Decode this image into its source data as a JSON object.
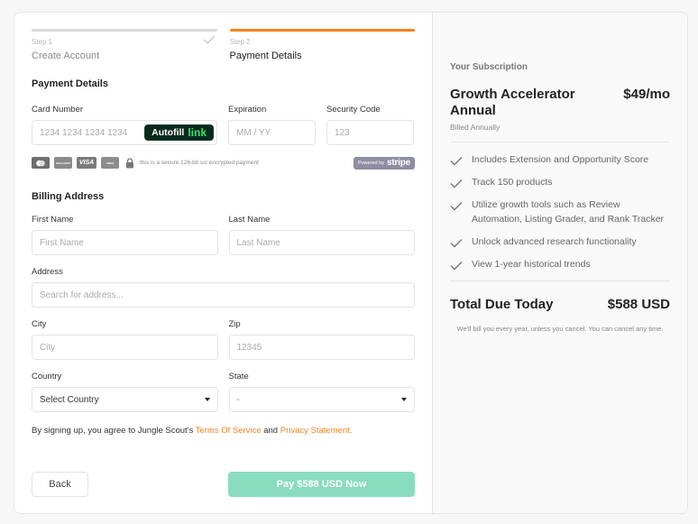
{
  "steps": [
    {
      "num": "Step 1",
      "title": "Create Account",
      "completed": true
    },
    {
      "num": "Step 2",
      "title": "Payment Details",
      "active": true
    }
  ],
  "payment": {
    "section_title": "Payment Details",
    "card_number": {
      "label": "Card Number",
      "placeholder": "1234 1234 1234 1234"
    },
    "autofill": {
      "text": "Autofill",
      "link": "link"
    },
    "expiration": {
      "label": "Expiration",
      "placeholder": "MM / YY"
    },
    "security_code": {
      "label": "Security Code",
      "placeholder": "123"
    },
    "card_brands": [
      "mastercard",
      "discover",
      "visa",
      "amex"
    ],
    "visa_text": "VISA",
    "secure_text": "this is a secure 128-bit ssl encrypted payment",
    "stripe": {
      "powered_by": "Powered by",
      "brand": "stripe"
    }
  },
  "billing": {
    "section_title": "Billing Address",
    "first_name": {
      "label": "First Name",
      "placeholder": "First Name"
    },
    "last_name": {
      "label": "Last Name",
      "placeholder": "Last Name"
    },
    "address": {
      "label": "Address",
      "placeholder": "Search for address..."
    },
    "city": {
      "label": "City",
      "placeholder": "City"
    },
    "zip": {
      "label": "Zip",
      "placeholder": "12345"
    },
    "country": {
      "label": "Country",
      "value": "Select Country"
    },
    "state": {
      "label": "State",
      "value": "-"
    }
  },
  "terms": {
    "prefix": "By signing up, you agree to Jungle Scout's ",
    "tos": "Terms Of Service",
    "and": " and ",
    "privacy": "Privacy Statement."
  },
  "buttons": {
    "back": "Back",
    "pay": "Pay $588 USD Now"
  },
  "subscription": {
    "heading": "Your Subscription",
    "plan_name": "Growth Accelerator Annual",
    "price": "$49/mo",
    "billed": "Billed Annually",
    "features": [
      "Includes Extension and Opportunity Score",
      "Track 150 products",
      "Utilize growth tools such as Review Automation, Listing Grader, and Rank Tracker",
      "Unlock advanced research functionality",
      "View 1-year historical trends"
    ],
    "total_label": "Total Due Today",
    "total_value": "$588 USD",
    "note": "We'll bill you every year, unless you cancel. You can cancel any time."
  },
  "colors": {
    "accent": "#f5821f",
    "pay_button": "#8adcbe",
    "autofill_bg": "#0a2a1e",
    "autofill_link": "#2ee26e",
    "stripe_badge": "#8e8ea3"
  }
}
